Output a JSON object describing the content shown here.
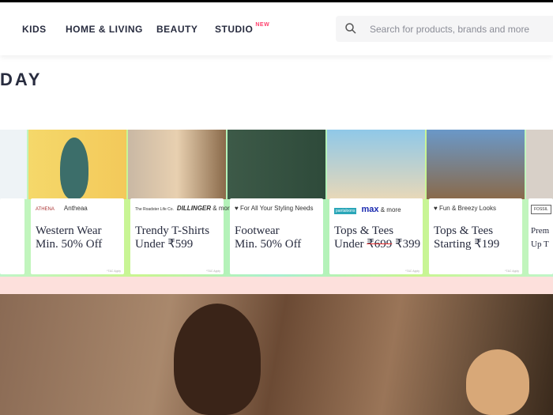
{
  "nav": [
    {
      "label": "KIDS"
    },
    {
      "label": "HOME & LIVING"
    },
    {
      "label": "BEAUTY"
    },
    {
      "label": "STUDIO",
      "badge": "NEW"
    }
  ],
  "search": {
    "placeholder": "Search for products, brands and more",
    "icon": "search-icon"
  },
  "section_title": "DAY",
  "cards": [
    {
      "brand": "Antheaa",
      "brand_logo": "ATHENA",
      "line1": "Western Wear",
      "line2": "Min. 50% Off",
      "tnc": "*T&C Apply"
    },
    {
      "brand": "DILLINGER",
      "brand_logo": "The Roadster Life Co.",
      "extra": "& more",
      "line1": "Trendy T-Shirts",
      "line2": "Under ₹599",
      "tnc": "*T&C Apply"
    },
    {
      "brand": "♥ For All Your Styling Needs",
      "line1": "Footwear",
      "line2": "Min. 50% Off"
    },
    {
      "brand": "max",
      "brand_logo": "pantaloons",
      "extra": "& more",
      "line1": "Tops & Tees",
      "line2_prefix": "Under",
      "old_price": "₹699",
      "new_price": "₹399",
      "tnc": "*T&C Apply"
    },
    {
      "brand": "♥ Fun & Breezy Looks",
      "line1": "Tops & Tees",
      "line2": "Starting ₹199",
      "tnc": "*T&C Apply"
    },
    {
      "brand_logo": "FOSSIL",
      "line1": "Prem",
      "line2": "Up T"
    }
  ],
  "colors": {
    "accent": "#ff3f6c",
    "text": "#282c3f"
  }
}
